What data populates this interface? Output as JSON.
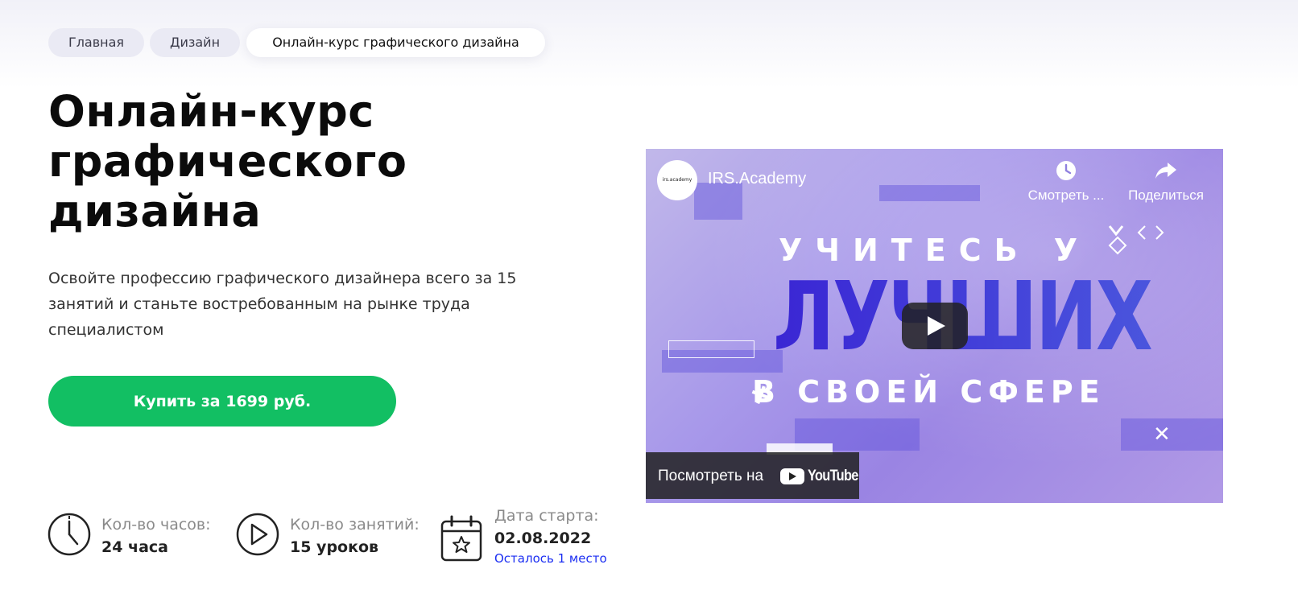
{
  "breadcrumb": [
    "Главная",
    "Дизайн",
    "Онлайн-курс графического дизайна"
  ],
  "hero": {
    "title_lines": [
      "Онлайн-курс",
      "графического",
      "дизайна"
    ],
    "description_lines": [
      "Освойте профессию графического дизайнера всего за 15",
      "занятий и станьте востребованным на рынке труда",
      "специалистом"
    ],
    "buy_button": "Купить за 1699 руб."
  },
  "stats": {
    "hours_label": "Кол-во часов:",
    "hours_value": "24 часа",
    "lessons_label": "Кол-во занятий:",
    "lessons_value": "15 уроков",
    "start_label": "Дата старта:",
    "start_value": "02.08.2022",
    "seats_note": "Осталось 1 место"
  },
  "video": {
    "channel_logo_text": "irs.academy",
    "channel_name": "IRS.Academy",
    "watch_later": "Смотреть ...",
    "share": "Поделиться",
    "thumb_line1": "УЧИТЕСЬ У",
    "thumb_line2": "ЛУЧШИХ",
    "thumb_line3": "В СВОЕЙ СФЕРЕ",
    "watch_on": "Посмотреть на",
    "youtube_word": "YouTube"
  },
  "colors": {
    "accent_green": "#12bf63",
    "link_blue": "#1b2ef2",
    "thumb_purple": "#3f33d6"
  },
  "icons": [
    "clock-icon",
    "play-circle-icon",
    "calendar-star-icon",
    "watch-later-icon",
    "share-icon",
    "play-button-icon",
    "youtube-logo-icon"
  ]
}
